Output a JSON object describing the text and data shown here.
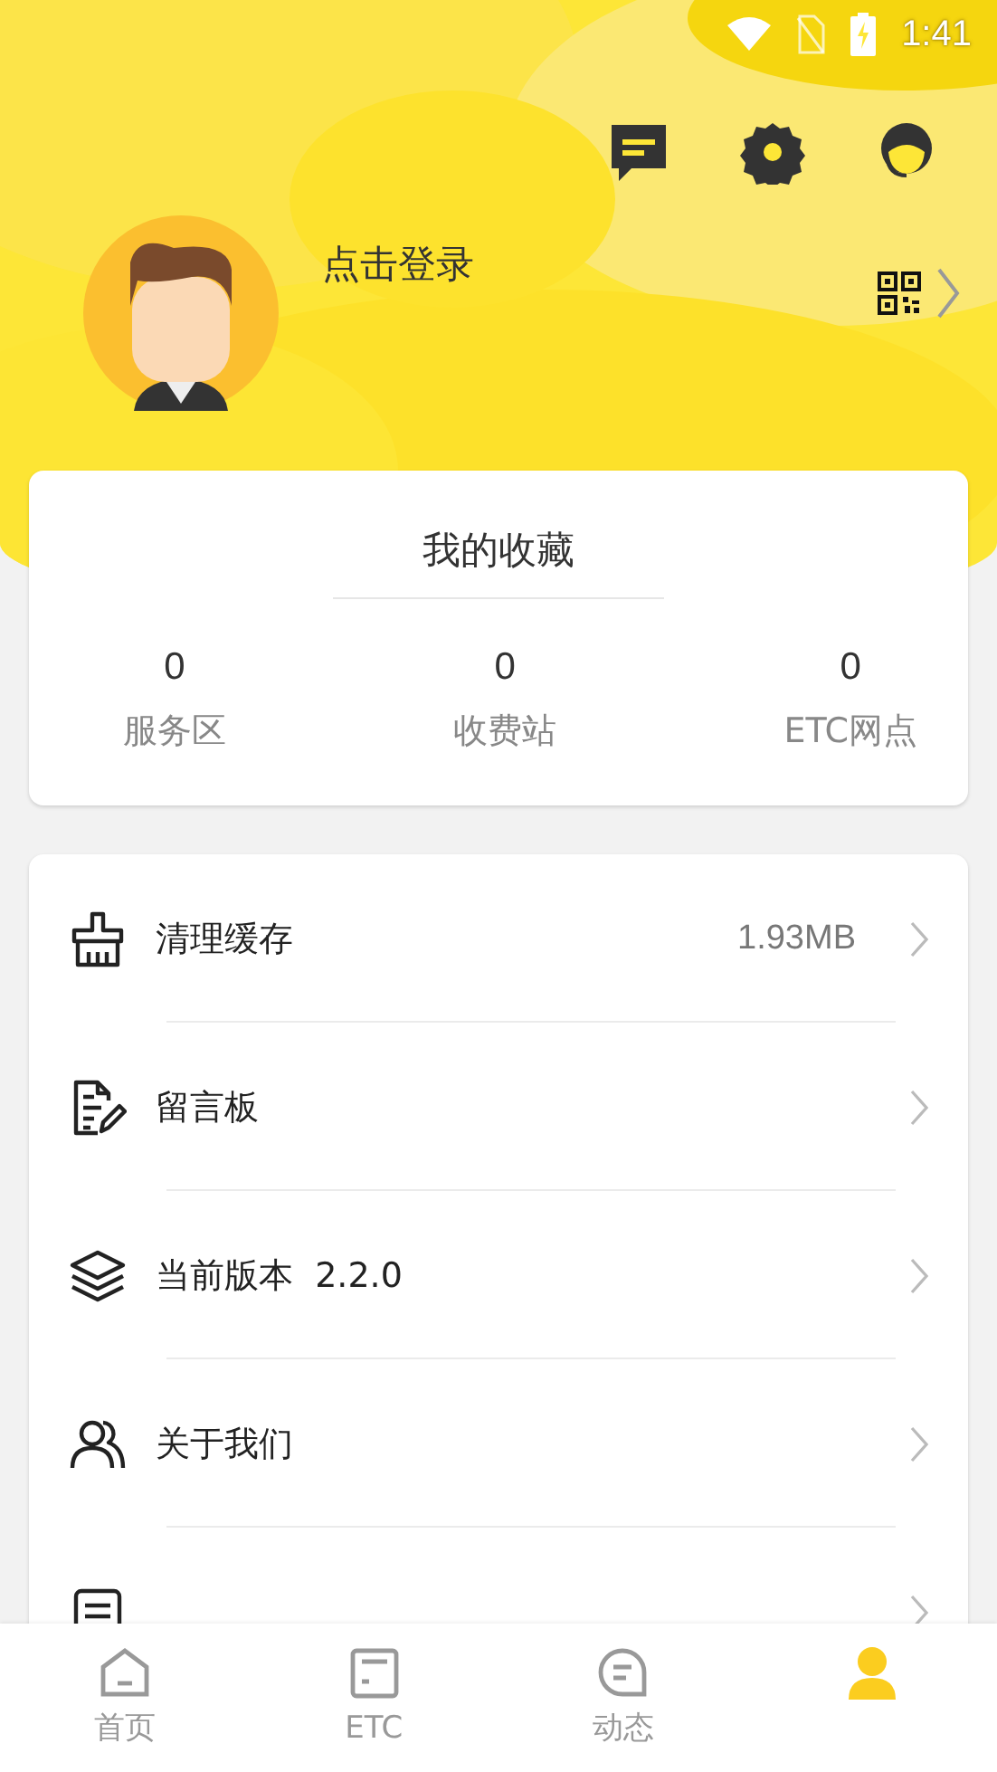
{
  "status_bar": {
    "time": "1:41"
  },
  "profile": {
    "login_text": "点击登录"
  },
  "favorites": {
    "title": "我的收藏",
    "stats": [
      {
        "value": "0",
        "label": "服务区"
      },
      {
        "value": "0",
        "label": "收费站"
      },
      {
        "value": "0",
        "label": "ETC网点"
      }
    ]
  },
  "menu": [
    {
      "kind": "broom",
      "label": "清理缓存",
      "value": "1.93MB"
    },
    {
      "kind": "note",
      "label": "留言板"
    },
    {
      "kind": "layers",
      "label": "当前版本  2.2.0"
    },
    {
      "kind": "people",
      "label": "关于我们"
    },
    {
      "kind": "doc"
    }
  ],
  "tabs": [
    {
      "kind": "home",
      "label": "首页",
      "selected": false
    },
    {
      "kind": "card",
      "label": "ETC",
      "selected": false
    },
    {
      "kind": "chat",
      "label": "动态",
      "selected": false
    },
    {
      "kind": "person",
      "selected": true
    }
  ]
}
